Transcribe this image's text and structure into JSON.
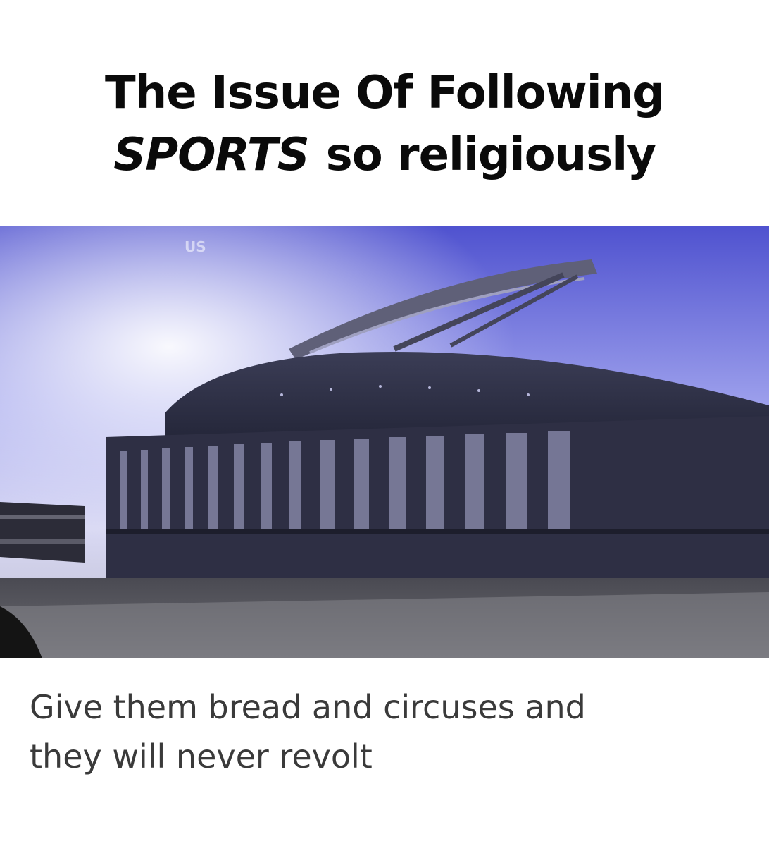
{
  "meme": {
    "title_line1": "The Issue Of Following",
    "title_emph": "SPORTS",
    "title_rest": "so religiously",
    "watermark": "US",
    "caption_line1": "Give them bread and circuses and",
    "caption_line2": "they will never revolt"
  },
  "colors": {
    "sky_top": "#5b5fd6",
    "sky_mid": "#c5c6ef",
    "stadium_dark": "#2a2a3a",
    "caption_text": "#3a3a3a",
    "title_text": "#0a0a0a"
  }
}
